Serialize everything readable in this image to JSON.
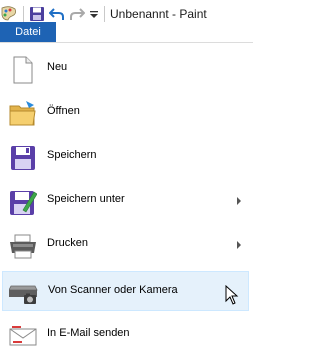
{
  "titlebar": {
    "app_title": "Unbenannt - Paint",
    "icons": [
      "paint-app-icon",
      "save-icon",
      "undo-icon",
      "redo-icon",
      "customize-dropdown-icon"
    ]
  },
  "menu": {
    "tab_label": "Datei",
    "items": [
      {
        "label": "Neu",
        "icon": "new-document-icon",
        "submenu": false
      },
      {
        "label": "Öffnen",
        "icon": "open-folder-icon",
        "submenu": false
      },
      {
        "label": "Speichern",
        "icon": "save-icon",
        "submenu": false
      },
      {
        "label": "Speichern unter",
        "icon": "save-as-icon",
        "submenu": true
      },
      {
        "label": "Drucken",
        "icon": "printer-icon",
        "submenu": true
      },
      {
        "label": "Von Scanner oder Kamera",
        "icon": "scanner-camera-icon",
        "submenu": false,
        "hovered": true
      },
      {
        "label": "In E-Mail senden",
        "icon": "email-icon",
        "submenu": false
      }
    ]
  },
  "colors": {
    "tab_bg": "#1e63b4",
    "hover_bg": "#e5f1fb",
    "hover_border": "#cde8ff"
  }
}
